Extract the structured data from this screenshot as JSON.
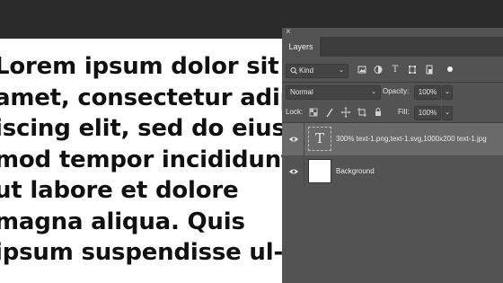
{
  "canvas": {
    "lines": [
      "Lorem ipsum dolor sit",
      "amet, consectetur adip",
      "iscing elit, sed do eius-",
      "mod tempor incididunt",
      "ut labore et dolore",
      "magna aliqua. Quis",
      "ipsum suspendisse ul-"
    ]
  },
  "panel": {
    "close_glyph": "×",
    "tab_label": "Layers",
    "filter": {
      "kind_label": "Kind",
      "icons": [
        "pixel-layer-filter-icon",
        "adjustment-layer-filter-icon",
        "type-layer-filter-icon",
        "shape-layer-filter-icon",
        "smart-object-filter-icon"
      ]
    },
    "blend_mode": "Normal",
    "opacity_label": "Opacity:",
    "opacity_value": "100%",
    "lock_label": "Lock:",
    "fill_label": "Fill:",
    "fill_value": "100%",
    "layers": [
      {
        "name": "300% text-1.png,text-1.svg,1000x200 text-1.jpg",
        "thumb_glyph": "T",
        "selected": true
      },
      {
        "name": "Background",
        "selected": false
      }
    ]
  }
}
